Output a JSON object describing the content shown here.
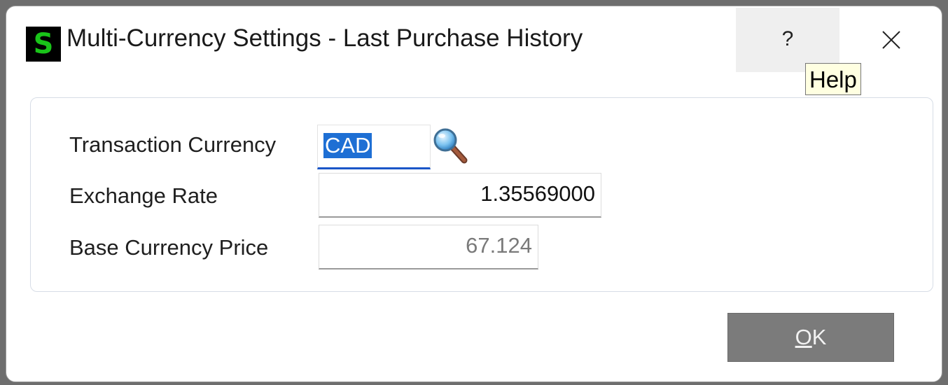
{
  "window": {
    "title": "Multi-Currency Settings - Last Purchase History",
    "app_icon_glyph": "S",
    "app_icon_color": "#19c419"
  },
  "titlebar": {
    "help_label": "?",
    "close_icon": "close-icon",
    "tooltip": "Help"
  },
  "form": {
    "transaction_currency_label": "Transaction Currency",
    "transaction_currency_value": "CAD",
    "lookup_icon": "magnifier-icon",
    "exchange_rate_label": "Exchange Rate",
    "exchange_rate_value": "1.35569000",
    "base_currency_price_label": "Base Currency Price",
    "base_currency_price_value": "67.124"
  },
  "buttons": {
    "ok_mnemonic": "O",
    "ok_rest": "K"
  },
  "colors": {
    "selection": "#1e6fd4",
    "focus_underline": "#1a56c8",
    "ok_button_bg": "#7b7b7b"
  }
}
